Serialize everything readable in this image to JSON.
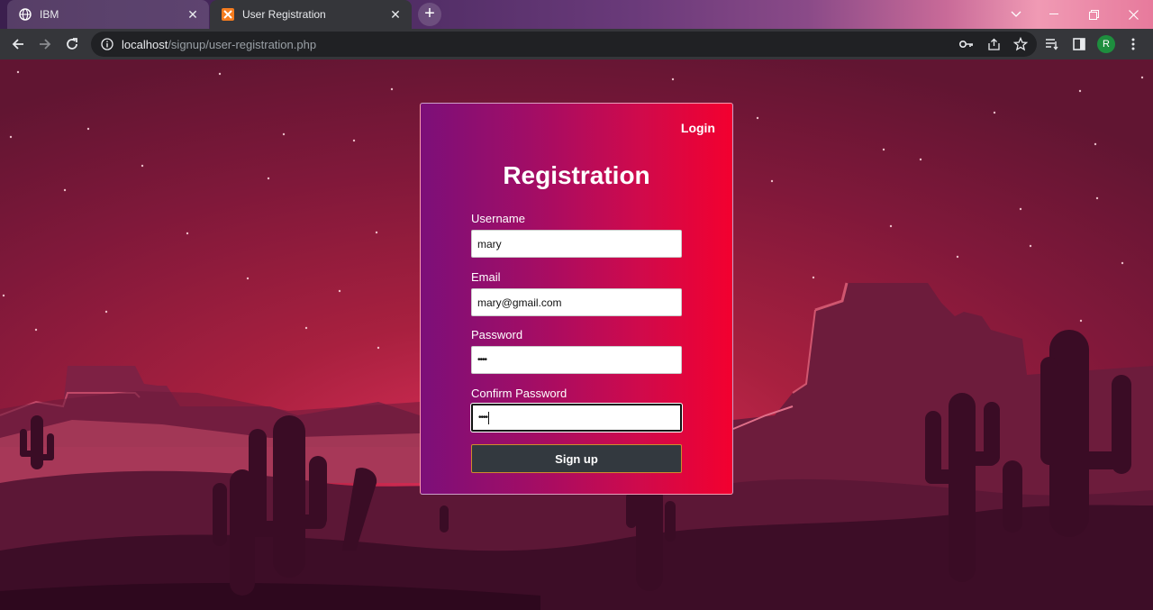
{
  "browser": {
    "tabs": [
      {
        "title": "IBM",
        "favicon": "globe-icon",
        "active": false
      },
      {
        "title": "User Registration",
        "favicon": "xampp-icon",
        "active": true
      }
    ],
    "url": {
      "host": "localhost",
      "path": "/signup/user-registration.php"
    },
    "profile_initial": "R"
  },
  "form": {
    "login_link": "Login",
    "heading": "Registration",
    "fields": [
      {
        "label": "Username",
        "value": "mary",
        "type": "text"
      },
      {
        "label": "Email",
        "value": "mary@gmail.com",
        "type": "text"
      },
      {
        "label": "Password",
        "value": "••••",
        "type": "password"
      },
      {
        "label": "Confirm Password",
        "value": "••••",
        "type": "password"
      }
    ],
    "submit_label": "Sign up"
  },
  "colors": {
    "card_gradient_start": "#7c0f79",
    "card_gradient_end": "#f3002f",
    "button_bg": "#33393f",
    "button_border": "#d08a2c",
    "sky": "#8a1a3e"
  }
}
